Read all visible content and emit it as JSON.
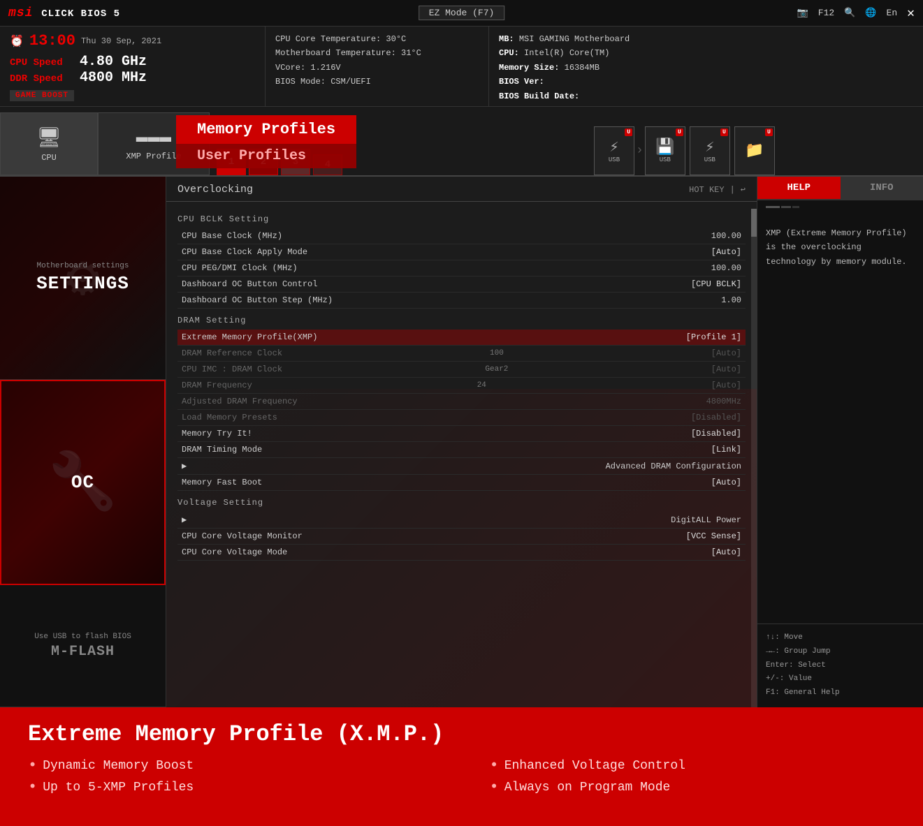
{
  "topbar": {
    "logo": "msi",
    "logo_suffix": "CLICK BIOS 5",
    "ez_mode": "EZ Mode (F7)",
    "f12": "F12",
    "lang": "En",
    "close": "✕"
  },
  "status": {
    "clock_icon": "⏱",
    "time": "13:00",
    "date": "Thu 30 Sep, 2021",
    "cpu_speed_label": "CPU Speed",
    "cpu_speed_val": "4.80 GHz",
    "ddr_speed_label": "DDR Speed",
    "ddr_speed_val": "4800 MHz",
    "game_boost": "GAME BOOST",
    "mid": {
      "cpu_temp": "CPU Core Temperature: 30°C",
      "mb_temp": "Motherboard Temperature: 31°C",
      "vcore": "VCore: 1.216V",
      "bios_mode": "BIOS Mode: CSM/UEFI"
    },
    "right": {
      "mb": "MB:",
      "mb_val": "MSI GAMING Motherboard",
      "cpu": "CPU:",
      "cpu_val": "Intel(R) Core(TM)",
      "mem": "Memory Size:",
      "mem_val": "16384MB",
      "bios_ver": "BIOS Ver:",
      "bios_ver_val": "",
      "bios_date": "BIOS Build Date:",
      "bios_date_val": ""
    }
  },
  "nav": {
    "cpu_tab": "CPU",
    "xmp_tab": "XMP Profile",
    "xmp_btn1": "1",
    "xmp_btn2": "2",
    "xmp_btn3": "3",
    "xmp_btn4": "4",
    "memory_profiles": "Memory Profiles",
    "user_profiles": "User Profiles",
    "usb_label": "USB"
  },
  "sidebar": {
    "settings_sub": "Motherboard settings",
    "settings_main": "SETTINGS",
    "oc_main": "OC",
    "mflash_sub": "Use USB to flash BIOS",
    "mflash_main": "M-FLASH"
  },
  "overclocking": {
    "title": "Overclocking",
    "hotkey": "HOT KEY",
    "sections": {
      "cpu_bclk": "CPU BCLK Setting",
      "dram": "DRAM Setting",
      "voltage": "Voltage Setting"
    },
    "settings": [
      {
        "name": "CPU Base Clock (MHz)",
        "val": "100.00",
        "dimmed": false,
        "highlighted": false
      },
      {
        "name": "CPU Base Clock Apply Mode",
        "val": "[Auto]",
        "dimmed": false,
        "highlighted": false
      },
      {
        "name": "CPU PEG/DMI Clock (MHz)",
        "val": "100.00",
        "dimmed": false,
        "highlighted": false
      },
      {
        "name": "Dashboard OC Button Control",
        "val": "[CPU BCLK]",
        "dimmed": false,
        "highlighted": false
      },
      {
        "name": "Dashboard OC Button Step (MHz)",
        "val": "1.00",
        "dimmed": false,
        "highlighted": false
      }
    ],
    "dram_settings": [
      {
        "name": "Extreme Memory Profile(XMP)",
        "val": "[Profile 1]",
        "dimmed": false,
        "highlighted": true,
        "sub": ""
      },
      {
        "name": "DRAM Reference Clock",
        "val": "[Auto]",
        "dimmed": true,
        "highlighted": false,
        "sub": "100"
      },
      {
        "name": "CPU IMC : DRAM Clock",
        "val": "[Auto]",
        "dimmed": true,
        "highlighted": false,
        "sub": "Gear2"
      },
      {
        "name": "DRAM Frequency",
        "val": "[Auto]",
        "dimmed": true,
        "highlighted": false,
        "sub": "24"
      },
      {
        "name": "Adjusted DRAM Frequency",
        "val": "4800MHz",
        "dimmed": true,
        "highlighted": false,
        "sub": ""
      },
      {
        "name": "Load Memory Presets",
        "val": "[Disabled]",
        "dimmed": true,
        "highlighted": false,
        "sub": ""
      },
      {
        "name": "Memory Try It!",
        "val": "[Disabled]",
        "dimmed": false,
        "highlighted": false,
        "sub": ""
      },
      {
        "name": "DRAM Timing Mode",
        "val": "[Link]",
        "dimmed": false,
        "highlighted": false,
        "sub": ""
      },
      {
        "name": "▶ Advanced DRAM Configuration",
        "val": "",
        "dimmed": false,
        "highlighted": false,
        "sub": ""
      },
      {
        "name": "Memory Fast Boot",
        "val": "[Auto]",
        "dimmed": false,
        "highlighted": false,
        "sub": ""
      }
    ],
    "voltage_settings": [
      {
        "name": "▶ DigitALL Power",
        "val": "",
        "dimmed": false,
        "highlighted": false,
        "sub": ""
      },
      {
        "name": "CPU Core Voltage Monitor",
        "val": "[VCC Sense]",
        "dimmed": false,
        "highlighted": false,
        "sub": ""
      },
      {
        "name": "CPU Core Voltage Mode",
        "val": "[Auto]",
        "dimmed": false,
        "highlighted": false,
        "sub": ""
      }
    ]
  },
  "help_panel": {
    "help_tab": "HELP",
    "info_tab": "INFO",
    "content": "XMP (Extreme Memory Profile) is the overclocking technology by memory module.",
    "footer": [
      "↑↓: Move",
      "→←: Group Jump",
      "Enter: Select",
      "+/-: Value",
      "F1: General Help"
    ]
  },
  "bottom": {
    "title": "Extreme Memory Profile (X.M.P.)",
    "features": [
      "Dynamic Memory Boost",
      "Enhanced Voltage Control",
      "Up to 5-XMP Profiles",
      "Always on Program Mode"
    ]
  }
}
